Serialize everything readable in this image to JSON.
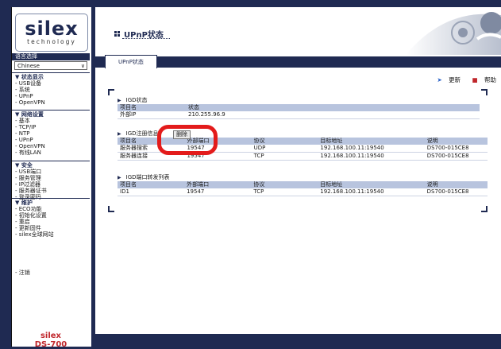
{
  "sidebar": {
    "logo_text": "silex",
    "logo_subtext": "technology",
    "lang_title": "语言选择",
    "lang_value": "Chinese",
    "groups": [
      {
        "head": "▼ 状态显示",
        "items": [
          "- USB设备",
          "- 系统",
          "- UPnP",
          "- OpenVPN"
        ]
      },
      {
        "head": "▼ 网络设置",
        "items": [
          "- 基本",
          "- TCP/IP",
          "- NTP",
          "- UPnP",
          "- OpenVPN",
          "- 有线LAN"
        ]
      },
      {
        "head": "▼ 安全",
        "items": [
          "- USB端口",
          "- 服务管理",
          "- IP过滤器",
          "- 服务器证书",
          "- 登录密码"
        ]
      },
      {
        "head": "▼ 维护",
        "items": [
          "- ECO功能",
          "- 初始化设置",
          "- 重启",
          "- 更新固件",
          "- silex全球网站"
        ]
      }
    ],
    "logout": "- 注销",
    "brand_line1": "silex",
    "brand_line2": "DS-700"
  },
  "header": {
    "title": "UPnP状态",
    "tab_label": "UPnP状态"
  },
  "toolbar": {
    "refresh_label": "更新",
    "help_label": "帮助"
  },
  "igd_status": {
    "title": "IGD状态",
    "columns": [
      "项目名",
      "状态"
    ],
    "rows": [
      [
        "外部IP",
        "210.255.96.9"
      ]
    ]
  },
  "igd_reg": {
    "title": "IGD注册信息",
    "delete_label": "删除",
    "columns": [
      "项目名",
      "外部端口",
      "协议",
      "目标地址",
      "说明"
    ],
    "rows": [
      [
        "服务器搜索",
        "19547",
        "UDP",
        "192.168.100.11:19540",
        "DS700-015CE8"
      ],
      [
        "服务器连接",
        "19547",
        "TCP",
        "192.168.100.11:19540",
        "DS700-015CE8"
      ]
    ]
  },
  "igd_forward": {
    "title": "IGD端口转发列表",
    "columns": [
      "项目名",
      "外部端口",
      "协议",
      "目标地址",
      "说明"
    ],
    "rows": [
      [
        "ID1",
        "19547",
        "TCP",
        "192.168.100.11:19540",
        "DS700-015CE8"
      ]
    ]
  },
  "colors": {
    "navy": "#1f2a52",
    "table_head": "#b8c4de",
    "highlight": "#e31b1b",
    "brand": "#c0262b"
  }
}
